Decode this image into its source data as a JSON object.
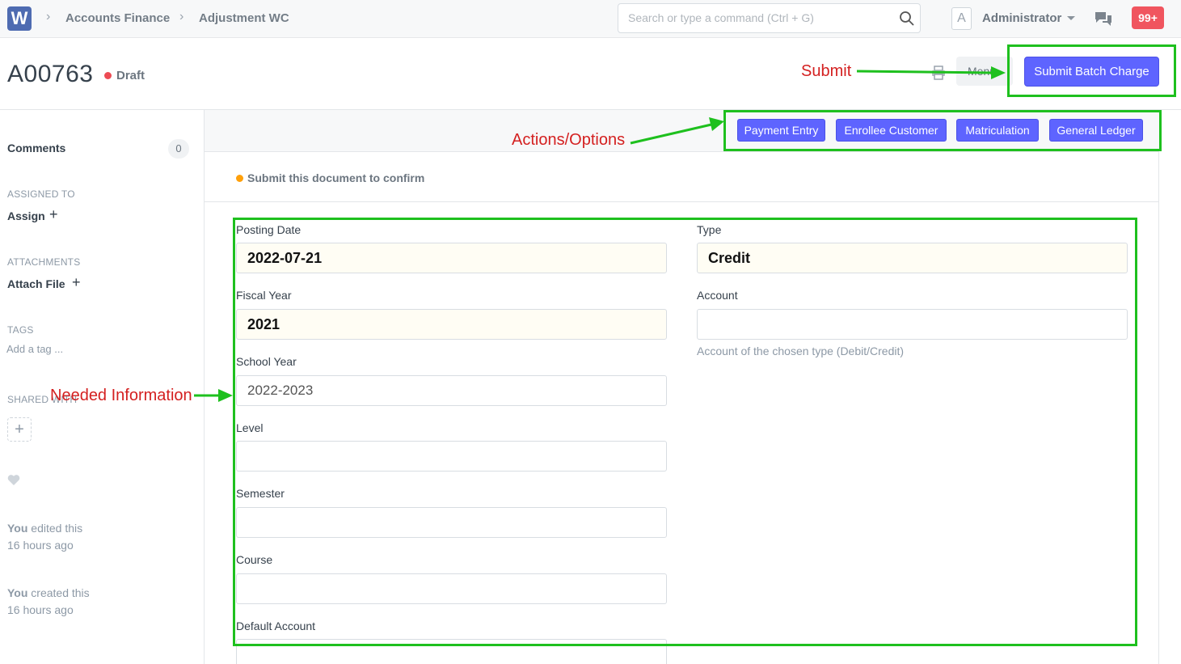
{
  "navbar": {
    "logo_letter": "W",
    "breadcrumbs": [
      "Accounts Finance",
      "Adjustment WC"
    ],
    "search_placeholder": "Search or type a command (Ctrl + G)",
    "avatar_letter": "A",
    "user_name": "Administrator",
    "notification_count": "99+"
  },
  "page": {
    "doc_name": "A00763",
    "status": "Draft",
    "menu_label": "Menu",
    "primary_action": "Submit Batch Charge",
    "colors": {
      "primary": "#5e64ff",
      "draft": "#ed4b54",
      "pending": "#ffa00a",
      "annotation_box": "#1ec01e",
      "annotation_text": "#d42020"
    }
  },
  "sidebar": {
    "comments_label": "Comments",
    "comments_count": "0",
    "assigned_to_label": "ASSIGNED TO",
    "assign_label": "Assign",
    "attachments_label": "ATTACHMENTS",
    "attach_label": "Attach File",
    "tags_label": "TAGS",
    "add_tag": "Add a tag ...",
    "shared_with_label": "SHARED WITH",
    "activity": [
      {
        "actor": "You",
        "action": "edited this",
        "when": "16 hours ago"
      },
      {
        "actor": "You",
        "action": "created this",
        "when": "16 hours ago"
      }
    ]
  },
  "actions": [
    "Payment Entry",
    "Enrollee Customer",
    "Matriculation",
    "General Ledger"
  ],
  "form": {
    "notice": "Submit this document to confirm",
    "left": [
      {
        "label": "Posting Date",
        "value": "2022-07-21",
        "filled": true
      },
      {
        "label": "Fiscal Year",
        "value": "2021",
        "filled": true
      },
      {
        "label": "School Year",
        "value": "2022-2023",
        "filled": false
      },
      {
        "label": "Level",
        "value": "",
        "filled": false
      },
      {
        "label": "Semester",
        "value": "",
        "filled": false
      },
      {
        "label": "Course",
        "value": "",
        "filled": false
      },
      {
        "label": "Default Account",
        "value": "",
        "filled": false
      }
    ],
    "right": [
      {
        "label": "Type",
        "value": "Credit",
        "filled": true
      },
      {
        "label": "Account",
        "value": "",
        "filled": false,
        "help": "Account of the chosen type (Debit/Credit)"
      }
    ]
  },
  "annotations": {
    "submit": "Submit",
    "actions": "Actions/Options",
    "needed_info": "Needed Information"
  }
}
